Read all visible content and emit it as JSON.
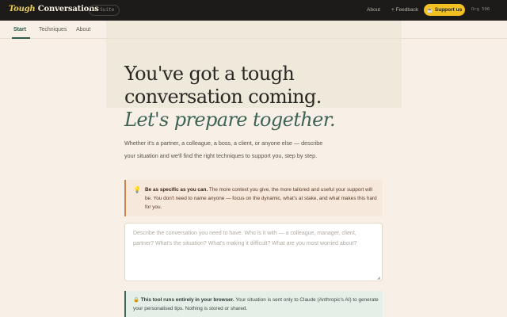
{
  "topbar": {
    "brand_italic": "Tough",
    "brand_rest": "Conversations",
    "suite": "← Suite",
    "about": "About",
    "feedback": "+ Feedback",
    "support_icon": "☕",
    "support": "Support us",
    "org": "Org 596"
  },
  "subnav": {
    "items": [
      "Start",
      "Techniques",
      "About"
    ]
  },
  "hero": {
    "line1": "You've got a tough",
    "line2": "conversation coming.",
    "line3": "Let's prepare together."
  },
  "intro": "Whether it's a partner, a colleague, a boss, a client, or anyone else — describe your situation and we'll find the right techniques to support you, step by step.",
  "tip": {
    "icon": "💡",
    "title": "Be as specific as you can.",
    "body": " The more context you give, the more tailored and useful your support will be. You don't need to name anyone — focus on the dynamic, what's at stake, and what makes this hard for you."
  },
  "situation": {
    "value": "",
    "placeholder": "Describe the conversation you need to have. Who is it with — a colleague, manager, client, partner? What's the situation? What's making it difficult? What are you most worried about?"
  },
  "privacy": {
    "icon": "🔒",
    "title": "This tool runs entirely in your browser.",
    "body": " Your situation is sent only to Claude (Anthropic's AI) to generate your personalised tips. Nothing is stored or shared."
  },
  "colors": {
    "topbar": "#1c1b19",
    "accent_yellow": "#f2c021",
    "accent_green": "#3d6454",
    "background": "#f8efe6",
    "tip_border": "#c9834d"
  }
}
